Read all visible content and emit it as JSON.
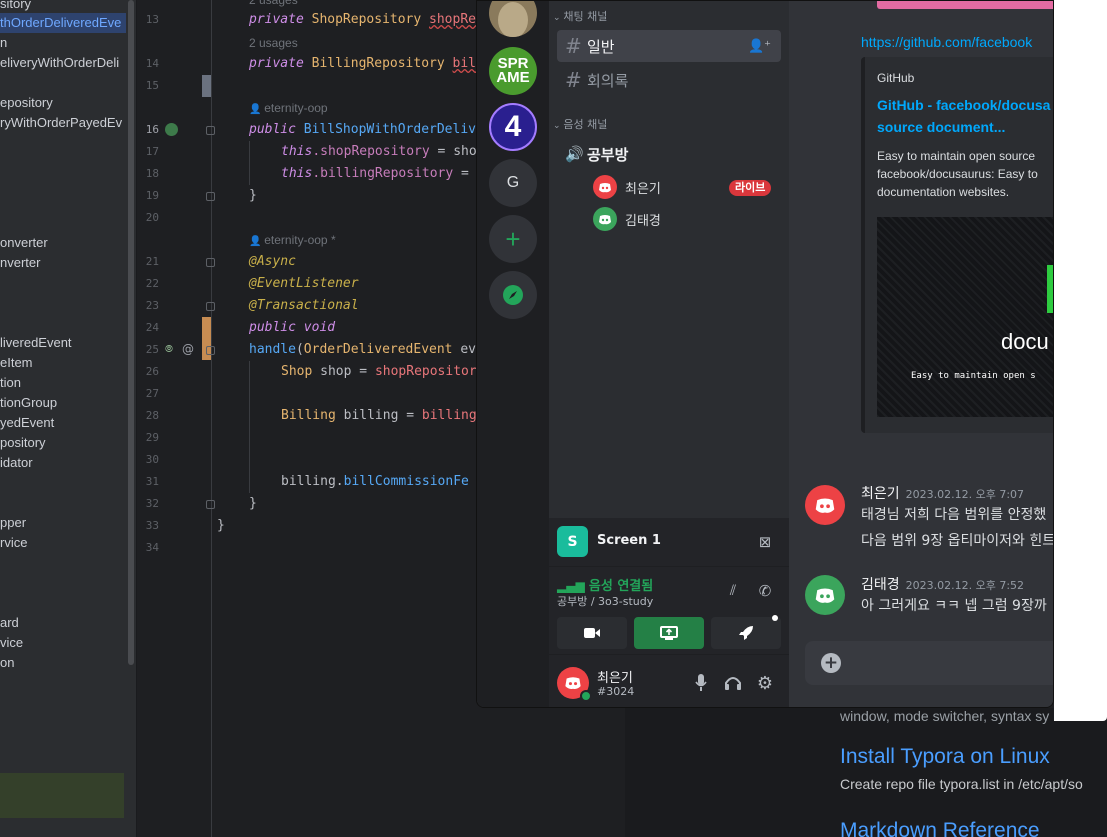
{
  "ide": {
    "project_tree": [
      {
        "text": "sitory"
      },
      {
        "text": "thOrderDeliveredEve",
        "selected": true
      },
      {
        "text": "n"
      },
      {
        "text": "eliveryWithOrderDeli"
      },
      {
        "text": "epository"
      },
      {
        "text": "ryWithOrderPayedEv"
      },
      {
        "text": "onverter"
      },
      {
        "text": "nverter"
      },
      {
        "text": "liveredEvent"
      },
      {
        "text": "eItem"
      },
      {
        "text": "tion"
      },
      {
        "text": "tionGroup"
      },
      {
        "text": "yedEvent"
      },
      {
        "text": "pository"
      },
      {
        "text": "idator"
      },
      {
        "text": "pper"
      },
      {
        "text": "rvice"
      },
      {
        "text": "ard"
      },
      {
        "text": "vice"
      },
      {
        "text": "on"
      }
    ],
    "line_numbers": [
      "13",
      "14",
      "15",
      "16",
      "17",
      "18",
      "19",
      "20",
      "21",
      "22",
      "23",
      "24",
      "25",
      "26",
      "27",
      "28",
      "29",
      "30",
      "31",
      "32",
      "33",
      "34"
    ],
    "hints": {
      "usages_top": "2 usages",
      "usages_14": "2 usages",
      "author_16": "eternity-oop",
      "author_21": "eternity-oop *"
    },
    "code": {
      "l13_kw": "private ",
      "l13_type": "ShopRepository ",
      "l13_field": "shopRe",
      "l14_kw": "private ",
      "l14_type": "BillingRepository ",
      "l14_field": "bil",
      "l16_kw": "public ",
      "l16_fn": "BillShopWithOrderDeliv",
      "l17_kw": "this",
      "l17_field": ".shopRepository",
      "l17_rest": " = sho",
      "l18_kw": "this",
      "l18_field": ".billingRepository",
      "l18_rest": " =",
      "l19": "}",
      "l21": "@Async",
      "l22": "@EventListener",
      "l23": "@Transactional",
      "l24": "public void",
      "l25_fn": "handle",
      "l25_paren": "(",
      "l25_type": "OrderDeliveredEvent ",
      "l25_rest": "ev",
      "l26_type": "Shop ",
      "l26_var": "shop = ",
      "l26_call": "shopRepositor",
      "l28_type": "Billing ",
      "l28_var": "billing = ",
      "l28_call": "billing",
      "l31_var": "billing.",
      "l31_call": "billCommissionFe",
      "l32": "}",
      "l33": "}"
    }
  },
  "discord": {
    "guilds": [
      {
        "icon": "avatar-photo"
      },
      {
        "label": "SPR\nAME"
      },
      {
        "label": "4"
      },
      {
        "label": "G"
      },
      {
        "icon": "plus-icon"
      },
      {
        "icon": "compass-icon"
      }
    ],
    "categories": {
      "text": "채팅 채널",
      "voice": "음성 채널"
    },
    "text_channels": [
      {
        "name": "일반",
        "active": true
      },
      {
        "name": "회의록"
      }
    ],
    "voice_channel": {
      "name": "공부방"
    },
    "voice_users": [
      {
        "name": "최은기",
        "live": "라이브"
      },
      {
        "name": "김태경"
      }
    ],
    "screen_share": {
      "label": "Screen 1"
    },
    "voice_status": {
      "title": "음성 연결됨",
      "channel": "공부방 / 3o3-study"
    },
    "user": {
      "name": "최은기",
      "tag": "#3024"
    },
    "chat": {
      "link": "https://github.com/facebook",
      "embed": {
        "provider": "GitHub",
        "title_line1": "GitHub - facebook/docusa",
        "title_line2": "source document...",
        "desc_line1": "Easy to maintain open source",
        "desc_line2": "facebook/docusaurus: Easy to",
        "desc_line3": "documentation websites.",
        "image_title": "docu",
        "image_sub": "Easy to maintain open s"
      },
      "messages": [
        {
          "author": "최은기",
          "timestamp": "2023.02.12. 오후 7:07",
          "lines": [
            "태경님 저희 다음 범위를 안정했",
            "다음 범위 9장 옵티마이저와 힌트"
          ]
        },
        {
          "author": "김태경",
          "timestamp": "2023.02.12. 오후 7:52",
          "lines": [
            "아 그러게요 ㅋㅋ 넵 그럼 9장까"
          ]
        }
      ]
    }
  },
  "browser": {
    "snippet_top": "window, mode switcher, syntax sy",
    "link1": "Install Typora on Linux",
    "text1": "Create repo file typora.list in /etc/apt/so",
    "link2": "Markdown Reference"
  }
}
